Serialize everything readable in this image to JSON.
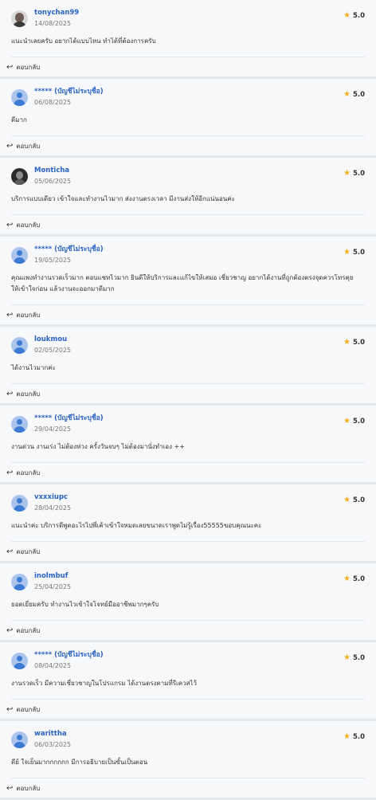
{
  "reply_label": "ตอบกลับ",
  "reviews": [
    {
      "name": "tonychan99",
      "date": "14/08/2025",
      "rating": "5.0",
      "text": "แนะนำเลยครับ อยากได้แบบไหน ทำได้ที่ต้องการครับ",
      "avatar": "photo"
    },
    {
      "name": "***** (บัญชีไม่ระบุชื่อ)",
      "date": "06/08/2025",
      "rating": "5.0",
      "text": "ดีมาก",
      "avatar": "default"
    },
    {
      "name": "Monticha",
      "date": "05/06/2025",
      "rating": "5.0",
      "text": "บริการแบบเดียว เข้าใจและทำงานไวมาก ส่งงานตรงเวลา มีงานส่งให้อีกแน่นอนค่ะ",
      "avatar": "dark"
    },
    {
      "name": "***** (บัญชีไม่ระบุชื่อ)",
      "date": "19/05/2025",
      "rating": "5.0",
      "text": "คุณแพงทำงานรวดเร็วมาก ตอบแชทไวมาก ยินดีให้บริการและแก้ไขให้เสมอ เชี่ยวชาญ อยากได้งานที่ถูกต้องตรงจุดควรโทรคุยให้เข้าใจก่อน แล้วงานจะออกมาดีมาก",
      "avatar": "default"
    },
    {
      "name": "loukmou",
      "date": "02/05/2025",
      "rating": "5.0",
      "text": "ได้งานไวมากค่ะ",
      "avatar": "default"
    },
    {
      "name": "***** (บัญชีไม่ระบุชื่อ)",
      "date": "29/04/2025",
      "rating": "5.0",
      "text": "งานด่วน งานเร่ง ไม่ต้องห่วง ครั้งวันจบๆ ไม่ต้องมานั่งทำเอง ++",
      "avatar": "default"
    },
    {
      "name": "vxxxiupc",
      "date": "28/04/2025",
      "rating": "5.0",
      "text": "แนะนำค่ะ บริการดีพูดอะไรไปพี่เค้าเข้าใจหมดเลยขนาดเราพูดไม่รู้เรื่อง55555ขอบคุณนะคะ",
      "avatar": "default"
    },
    {
      "name": "inolmbuf",
      "date": "25/04/2025",
      "rating": "5.0",
      "text": "ยอดเยี่ยมครับ ทำงานไวเข้าใจโจทย์มืออาชีพมากๆครับ",
      "avatar": "default"
    },
    {
      "name": "***** (บัญชีไม่ระบุชื่อ)",
      "date": "08/04/2025",
      "rating": "5.0",
      "text": "งานรวดเร็ว มีความเชี่ยวชาญในโปรแกรม ได้งานตรงตามที่รีเควสไว้",
      "avatar": "default"
    },
    {
      "name": "warittha",
      "date": "06/03/2025",
      "rating": "5.0",
      "text": "ดีย์ ใจเย็นมากกกกกก มีการอธิบายเป็นขั้นเป็นตอน",
      "avatar": "default"
    }
  ]
}
